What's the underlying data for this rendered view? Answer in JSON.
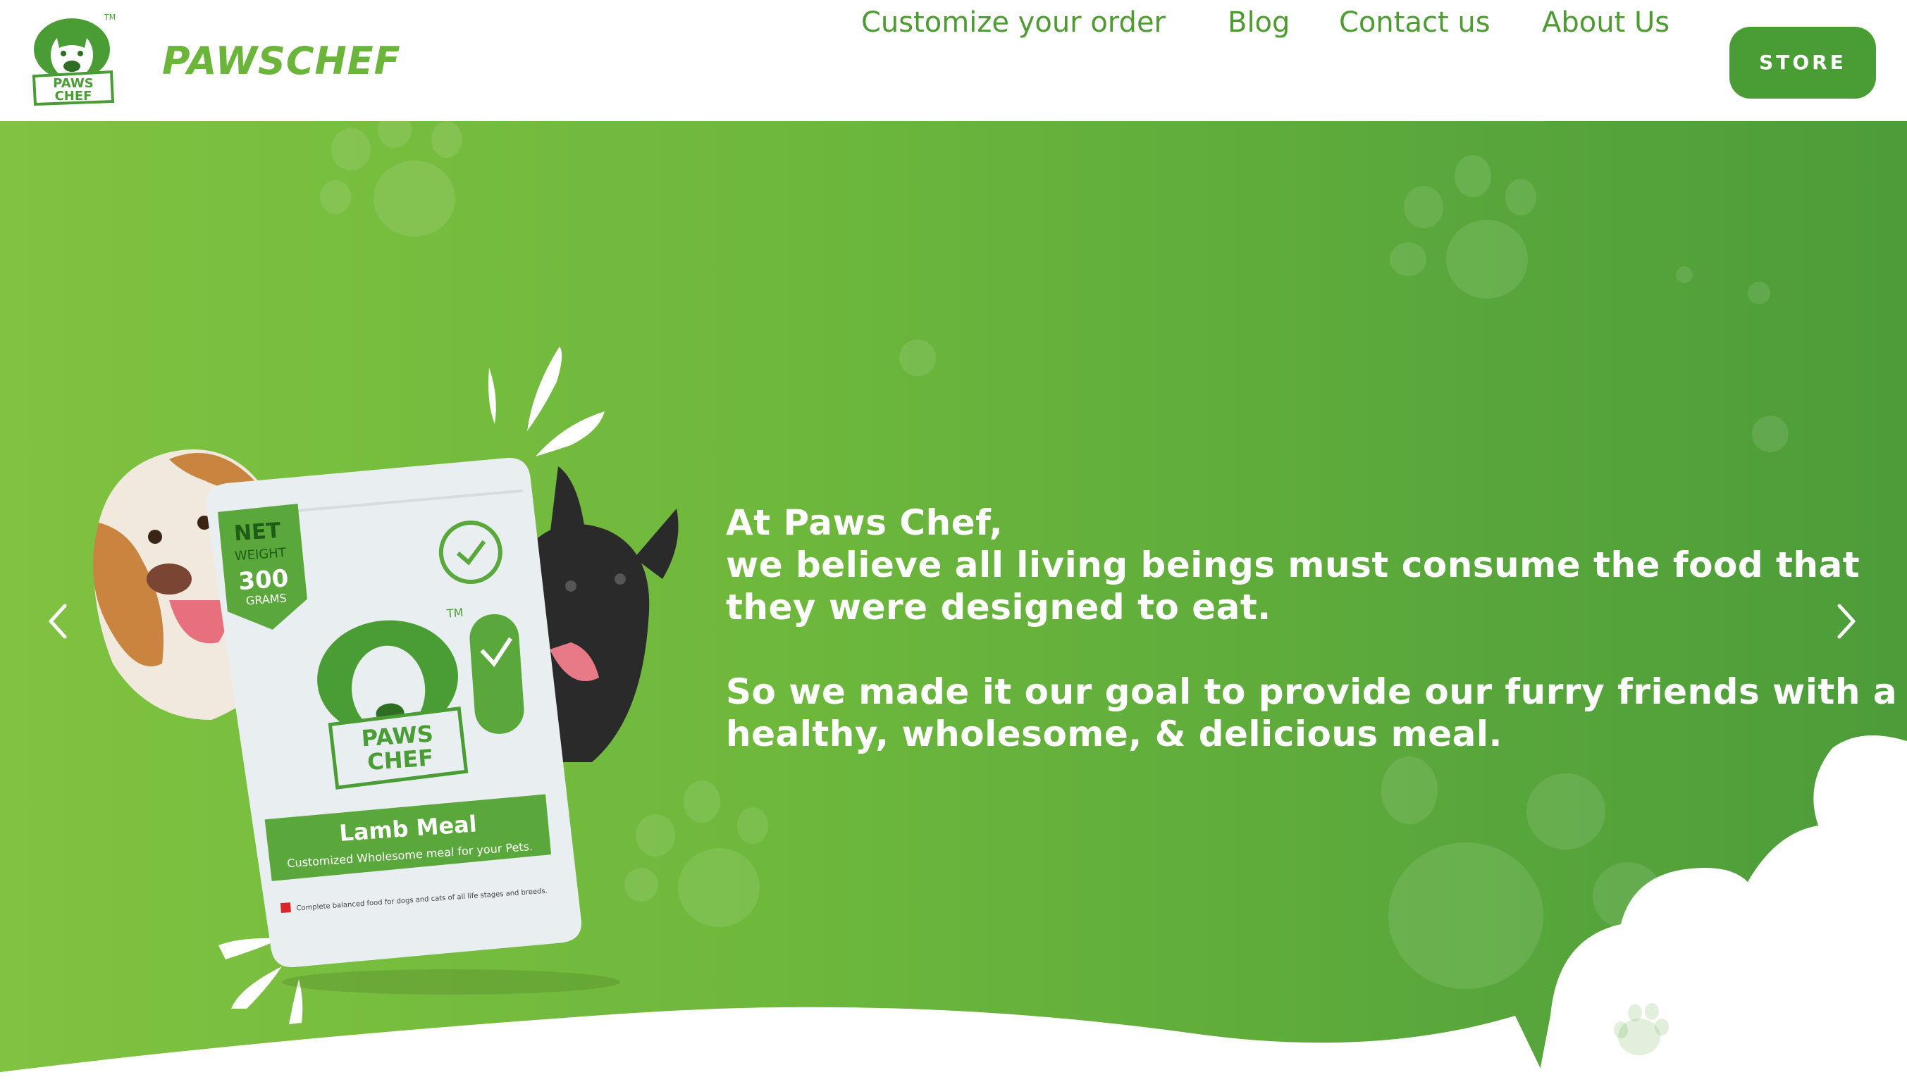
{
  "brand": {
    "logo_badge_text_line1": "PAWS",
    "logo_badge_text_line2": "CHEF",
    "logo_tm": "TM",
    "name": "PAWSCHEF"
  },
  "nav": {
    "items": [
      {
        "label": "Customize your order"
      },
      {
        "label": "Blog"
      },
      {
        "label": "Contact us"
      },
      {
        "label": "About Us"
      }
    ],
    "store_label": "STORE"
  },
  "hero": {
    "lines": [
      "At Paws Chef,",
      "we believe all living beings must consume the food that",
      "they were designed to eat.",
      "So we made it our goal to provide our furry friends with a",
      "healthy, wholesome, &  delicious meal."
    ],
    "package": {
      "net": "NET",
      "weight": "WEIGHT",
      "grams_value": "300",
      "grams_unit": "GRAMS",
      "brand_line1": "PAWS",
      "brand_line2": "CHEF",
      "tm": "TM",
      "product": "Lamb Meal",
      "tagline": "Customized Wholesome meal for your Pets.",
      "fine_print": "Complete balanced food for dogs and cats of all life stages and breeds."
    }
  },
  "colors": {
    "primary": "#4a9d34",
    "brand_text": "#6ab53a",
    "nav_text": "#4e9a33",
    "hero_start": "#80c241",
    "hero_end": "#4c9c3a",
    "white": "#ffffff"
  },
  "icons": {
    "prev": "chevron-left-icon",
    "next": "chevron-right-icon"
  }
}
